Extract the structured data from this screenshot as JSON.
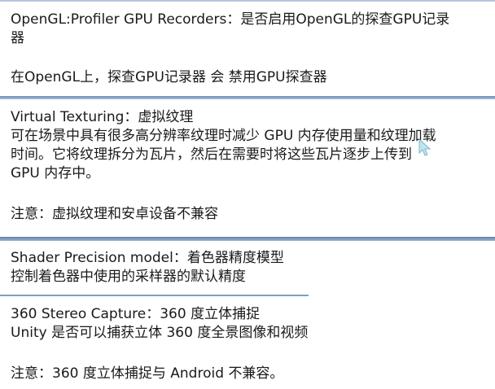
{
  "section1": {
    "title_line1": "OpenGL:Profiler GPU Recorders：是否启用OpenGL的探查GPU记录",
    "title_line2": "器",
    "note": "在OpenGL上，探查GPU记录器 会 禁用GPU探查器"
  },
  "section2": {
    "title": "Virtual Texturing：虚拟纹理",
    "desc_line1": "可在场景中具有很多高分辨率纹理时减少 GPU 内存使用量和纹理加载",
    "desc_line2": "时间。它将纹理拆分为瓦片，然后在需要时将这些瓦片逐步上传到",
    "desc_line3": "GPU 内存中。",
    "note": "注意：虚拟纹理和安卓设备不兼容"
  },
  "section3": {
    "title": "Shader Precision model：着色器精度模型",
    "desc": "控制着色器中使用的采样器的默认精度"
  },
  "section4": {
    "title": "360 Stereo Capture：360 度立体捕捉",
    "desc": "Unity 是否可以捕获立体 360 度全景图像和视频",
    "note": "注意：360 度立体捕捉与 Android 不兼容。"
  }
}
